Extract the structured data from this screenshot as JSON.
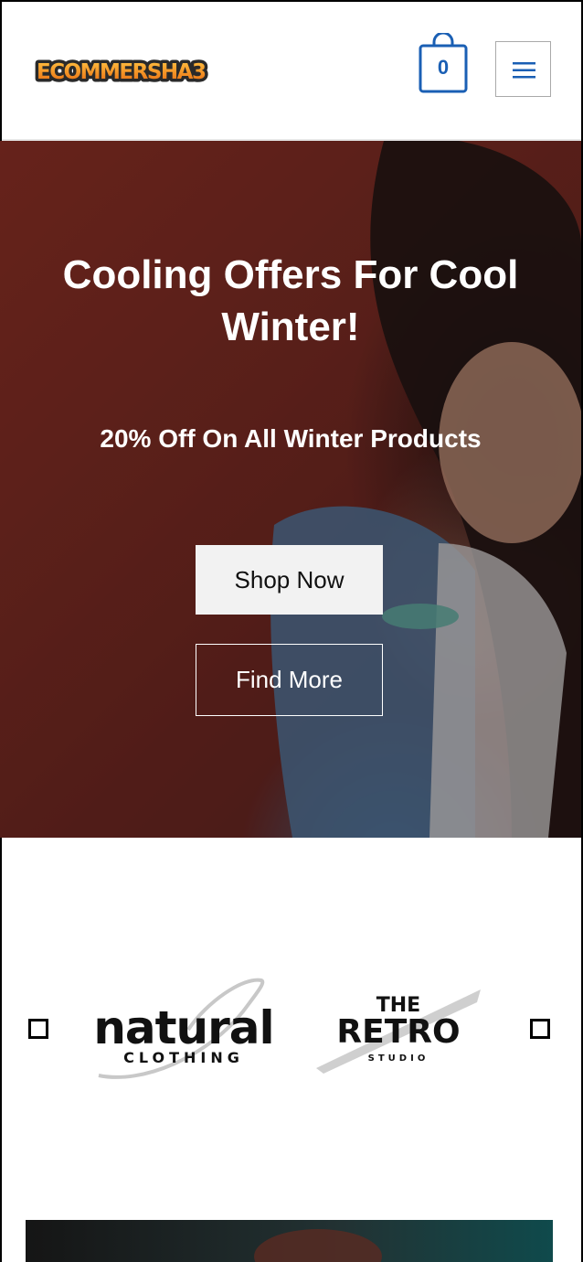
{
  "header": {
    "logo_text": "ECOMMERSHA3",
    "cart_count": "0",
    "menu_icon": "hamburger-icon"
  },
  "hero": {
    "title": "Cooling Offers For Cool Winter!",
    "subtitle": "20% Off On All Winter Products",
    "primary_button": "Shop Now",
    "secondary_button": "Find More"
  },
  "brands": {
    "items": [
      {
        "name": "natural",
        "tagline": "CLOTHING"
      },
      {
        "name_top": "THE",
        "name": "RETRO",
        "tagline": "STUDIO"
      }
    ]
  },
  "colors": {
    "accent": "#1a5fb4",
    "logo_orange": "#f08a1c"
  }
}
